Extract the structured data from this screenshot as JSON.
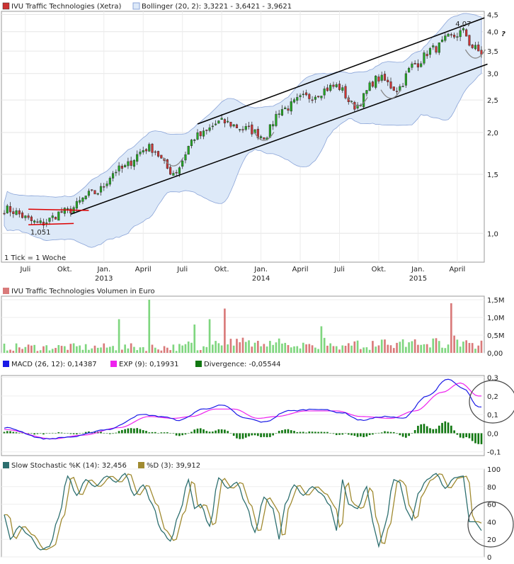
{
  "colors": {
    "up": "#22aa22",
    "down": "#cc3333",
    "volUp": "#7fd67f",
    "volDown": "#d97a7a",
    "band": "#dde9f8",
    "bandLine": "#8aa4d8",
    "macd": "#1a1ae6",
    "exp": "#ee22ee",
    "div": "#117711",
    "stochK": "#2d6f6f",
    "stochD": "#a08a30",
    "annot": "#333333",
    "red": "#dd0000"
  },
  "chart_data": [
    {
      "type": "candlestick",
      "title": "IVU Traffic Technologies (Xetra)",
      "legend": "Bollinger (20, 2): 3,3221 - 3,6421 - 3,9621",
      "note": "1 Tick = 1 Woche",
      "y_scale": "log",
      "ylim": [
        0.82,
        4.6
      ],
      "y_ticks": [
        {
          "v": 4.5,
          "t": "4,5"
        },
        {
          "v": 4.0,
          "t": "4,0"
        },
        {
          "v": 3.5,
          "t": "3,5"
        },
        {
          "v": 3.0,
          "t": "3,0"
        },
        {
          "v": 2.5,
          "t": "2,5"
        },
        {
          "v": 2.0,
          "t": "2,0"
        },
        {
          "v": 1.5,
          "t": "1,5"
        },
        {
          "v": 1.0,
          "t": "1,0"
        }
      ],
      "x_ticks": [
        {
          "w": 7,
          "t": "Juli"
        },
        {
          "w": 20,
          "t": "Okt."
        },
        {
          "w": 33,
          "t": "Jan."
        },
        {
          "w": 46,
          "t": "April"
        },
        {
          "w": 59,
          "t": "Juli"
        },
        {
          "w": 72,
          "t": "Okt."
        },
        {
          "w": 85,
          "t": "Jan."
        },
        {
          "w": 98,
          "t": "April"
        },
        {
          "w": 111,
          "t": "Juli"
        },
        {
          "w": 124,
          "t": "Okt."
        },
        {
          "w": 137,
          "t": "Jan."
        },
        {
          "w": 150,
          "t": "April"
        }
      ],
      "years": [
        {
          "w": 33,
          "t": "2013"
        },
        {
          "w": 85,
          "t": "2014"
        },
        {
          "w": 137,
          "t": "2015"
        }
      ],
      "labels": {
        "low": "1,051",
        "high": "4,07",
        "question": "?"
      },
      "key_closes": [
        {
          "w": 0,
          "v": 1.18
        },
        {
          "w": 12,
          "v": 1.07
        },
        {
          "w": 20,
          "v": 1.16
        },
        {
          "w": 30,
          "v": 1.32
        },
        {
          "w": 38,
          "v": 1.55
        },
        {
          "w": 48,
          "v": 1.8
        },
        {
          "w": 56,
          "v": 1.52
        },
        {
          "w": 64,
          "v": 1.95
        },
        {
          "w": 72,
          "v": 2.15
        },
        {
          "w": 80,
          "v": 2.05
        },
        {
          "w": 86,
          "v": 1.95
        },
        {
          "w": 92,
          "v": 2.35
        },
        {
          "w": 100,
          "v": 2.55
        },
        {
          "w": 110,
          "v": 2.75
        },
        {
          "w": 116,
          "v": 2.4
        },
        {
          "w": 124,
          "v": 2.9
        },
        {
          "w": 130,
          "v": 2.7
        },
        {
          "w": 136,
          "v": 3.2
        },
        {
          "w": 142,
          "v": 3.55
        },
        {
          "w": 148,
          "v": 3.85
        },
        {
          "w": 152,
          "v": 4.0
        },
        {
          "w": 155,
          "v": 3.6
        },
        {
          "w": 158,
          "v": 3.45
        }
      ]
    },
    {
      "type": "bar",
      "title": "IVU Traffic Technologies Volumen in Euro",
      "ylim": [
        0,
        1.6
      ],
      "y_ticks": [
        {
          "v": 1.5,
          "t": "1,5M"
        },
        {
          "v": 1.0,
          "t": "1,0M"
        },
        {
          "v": 0.5,
          "t": "0,5M"
        },
        {
          "v": 0.0,
          "t": "0,00"
        }
      ],
      "spikes": [
        {
          "w": 48,
          "v": 1.5
        },
        {
          "w": 38,
          "v": 0.95
        },
        {
          "w": 73,
          "v": 1.25
        },
        {
          "w": 68,
          "v": 0.95
        },
        {
          "w": 63,
          "v": 0.8
        },
        {
          "w": 148,
          "v": 1.4
        },
        {
          "w": 105,
          "v": 0.75
        }
      ]
    },
    {
      "type": "line",
      "legend": [
        {
          "name": "MACD (26, 12): 0,14387"
        },
        {
          "name": "EXP (9): 0,19931"
        },
        {
          "name": "Divergence: -0,05544"
        }
      ],
      "ylim": [
        -0.12,
        0.31
      ],
      "y_ticks": [
        {
          "v": 0.3,
          "t": "0,3"
        },
        {
          "v": 0.2,
          "t": "0,2"
        },
        {
          "v": 0.1,
          "t": "0,1"
        },
        {
          "v": 0.0,
          "t": "0,0"
        },
        {
          "v": -0.1,
          "t": "-0,1"
        }
      ],
      "macd_key": [
        {
          "w": 0,
          "v": 0.03
        },
        {
          "w": 14,
          "v": -0.03
        },
        {
          "w": 22,
          "v": -0.02
        },
        {
          "w": 34,
          "v": 0.02
        },
        {
          "w": 46,
          "v": 0.1
        },
        {
          "w": 52,
          "v": 0.09
        },
        {
          "w": 58,
          "v": 0.07
        },
        {
          "w": 66,
          "v": 0.13
        },
        {
          "w": 72,
          "v": 0.15
        },
        {
          "w": 80,
          "v": 0.08
        },
        {
          "w": 86,
          "v": 0.06
        },
        {
          "w": 94,
          "v": 0.12
        },
        {
          "w": 104,
          "v": 0.13
        },
        {
          "w": 112,
          "v": 0.11
        },
        {
          "w": 118,
          "v": 0.07
        },
        {
          "w": 126,
          "v": 0.09
        },
        {
          "w": 132,
          "v": 0.08
        },
        {
          "w": 140,
          "v": 0.2
        },
        {
          "w": 147,
          "v": 0.29
        },
        {
          "w": 152,
          "v": 0.24
        },
        {
          "w": 157,
          "v": 0.14
        }
      ],
      "exp_key": [
        {
          "w": 0,
          "v": 0.02
        },
        {
          "w": 16,
          "v": -0.03
        },
        {
          "w": 26,
          "v": -0.01
        },
        {
          "w": 38,
          "v": 0.03
        },
        {
          "w": 48,
          "v": 0.09
        },
        {
          "w": 56,
          "v": 0.08
        },
        {
          "w": 62,
          "v": 0.09
        },
        {
          "w": 70,
          "v": 0.13
        },
        {
          "w": 76,
          "v": 0.13
        },
        {
          "w": 84,
          "v": 0.08
        },
        {
          "w": 90,
          "v": 0.09
        },
        {
          "w": 100,
          "v": 0.12
        },
        {
          "w": 110,
          "v": 0.12
        },
        {
          "w": 118,
          "v": 0.09
        },
        {
          "w": 128,
          "v": 0.08
        },
        {
          "w": 136,
          "v": 0.12
        },
        {
          "w": 145,
          "v": 0.22
        },
        {
          "w": 151,
          "v": 0.27
        },
        {
          "w": 157,
          "v": 0.2
        }
      ]
    },
    {
      "type": "line",
      "legend": [
        {
          "name": "Slow Stochastic %K (14): 32,456"
        },
        {
          "name": "%D (3): 39,912"
        }
      ],
      "ylim": [
        0,
        100
      ],
      "y_ticks": [
        {
          "v": 100,
          "t": "100"
        },
        {
          "v": 80,
          "t": "80"
        },
        {
          "v": 60,
          "t": "60"
        },
        {
          "v": 40,
          "t": "40"
        },
        {
          "v": 20,
          "t": "20"
        },
        {
          "v": 0,
          "t": "0"
        }
      ],
      "k_key": [
        {
          "w": 0,
          "v": 48
        },
        {
          "w": 2,
          "v": 20
        },
        {
          "w": 5,
          "v": 35
        },
        {
          "w": 8,
          "v": 25
        },
        {
          "w": 12,
          "v": 8
        },
        {
          "w": 15,
          "v": 12
        },
        {
          "w": 18,
          "v": 45
        },
        {
          "w": 21,
          "v": 92
        },
        {
          "w": 24,
          "v": 70
        },
        {
          "w": 27,
          "v": 88
        },
        {
          "w": 30,
          "v": 80
        },
        {
          "w": 34,
          "v": 92
        },
        {
          "w": 37,
          "v": 85
        },
        {
          "w": 40,
          "v": 95
        },
        {
          "w": 43,
          "v": 70
        },
        {
          "w": 46,
          "v": 82
        },
        {
          "w": 49,
          "v": 60
        },
        {
          "w": 52,
          "v": 30
        },
        {
          "w": 55,
          "v": 18
        },
        {
          "w": 58,
          "v": 50
        },
        {
          "w": 61,
          "v": 88
        },
        {
          "w": 63,
          "v": 55
        },
        {
          "w": 65,
          "v": 60
        },
        {
          "w": 68,
          "v": 35
        },
        {
          "w": 71,
          "v": 90
        },
        {
          "w": 74,
          "v": 78
        },
        {
          "w": 77,
          "v": 85
        },
        {
          "w": 80,
          "v": 60
        },
        {
          "w": 83,
          "v": 28
        },
        {
          "w": 86,
          "v": 68
        },
        {
          "w": 89,
          "v": 55
        },
        {
          "w": 91,
          "v": 20
        },
        {
          "w": 93,
          "v": 60
        },
        {
          "w": 96,
          "v": 82
        },
        {
          "w": 99,
          "v": 70
        },
        {
          "w": 102,
          "v": 80
        },
        {
          "w": 105,
          "v": 72
        },
        {
          "w": 108,
          "v": 58
        },
        {
          "w": 110,
          "v": 30
        },
        {
          "w": 112,
          "v": 88
        },
        {
          "w": 114,
          "v": 60
        },
        {
          "w": 117,
          "v": 55
        },
        {
          "w": 120,
          "v": 80
        },
        {
          "w": 122,
          "v": 40
        },
        {
          "w": 124,
          "v": 12
        },
        {
          "w": 126,
          "v": 35
        },
        {
          "w": 129,
          "v": 88
        },
        {
          "w": 131,
          "v": 85
        },
        {
          "w": 133,
          "v": 55
        },
        {
          "w": 135,
          "v": 42
        },
        {
          "w": 137,
          "v": 72
        },
        {
          "w": 140,
          "v": 88
        },
        {
          "w": 143,
          "v": 95
        },
        {
          "w": 146,
          "v": 78
        },
        {
          "w": 149,
          "v": 90
        },
        {
          "w": 152,
          "v": 92
        },
        {
          "w": 154,
          "v": 40
        },
        {
          "w": 156,
          "v": 40
        },
        {
          "w": 158,
          "v": 30
        }
      ]
    }
  ]
}
